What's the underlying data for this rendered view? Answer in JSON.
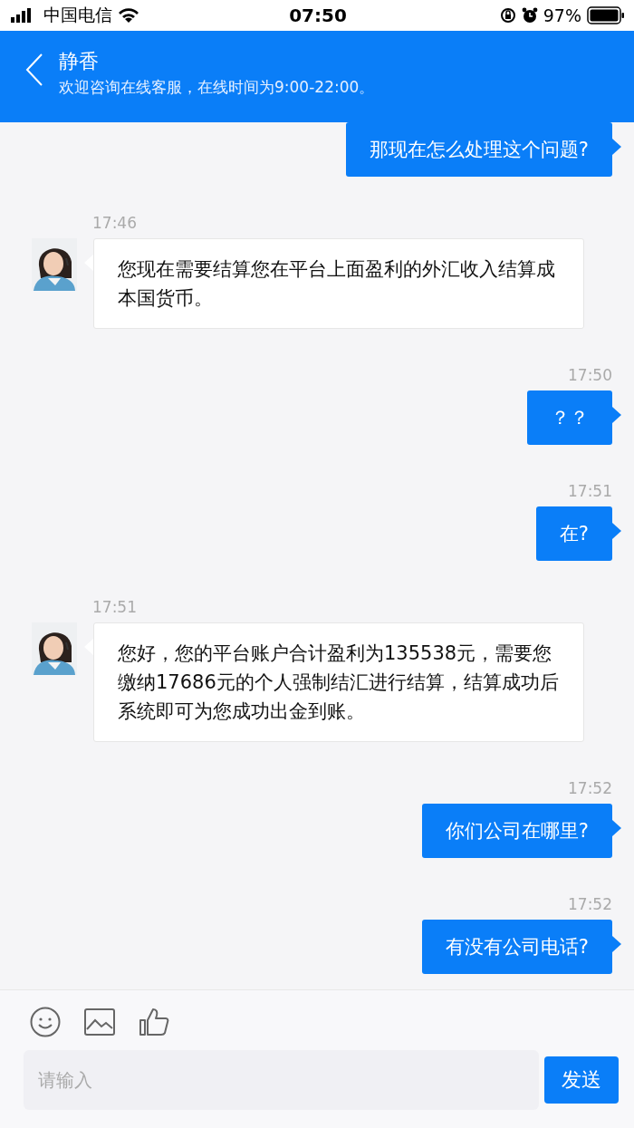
{
  "status_bar": {
    "carrier": "中国电信",
    "time": "07:50",
    "battery": "97%"
  },
  "header": {
    "title": "静香",
    "subtitle": "欢迎咨询在线客服，在线时间为9:00-22:00。"
  },
  "messages": [
    {
      "kind": "sent",
      "text": "那现在怎么处理这个问题?"
    },
    {
      "kind": "received",
      "time": "17:46",
      "text": "您现在需要结算您在平台上面盈利的外汇收入结算成本国货币。"
    },
    {
      "kind": "sent",
      "time": "17:50",
      "text": "？？"
    },
    {
      "kind": "sent",
      "time": "17:51",
      "text": "在?"
    },
    {
      "kind": "received",
      "time": "17:51",
      "text": "您好，您的平台账户合计盈利为135538元，需要您缴纳17686元的个人强制结汇进行结算，结算成功后系统即可为您成功出金到账。"
    },
    {
      "kind": "sent",
      "time": "17:52",
      "text": "你们公司在哪里?"
    },
    {
      "kind": "sent",
      "time": "17:52",
      "text": "有没有公司电话?"
    }
  ],
  "composer": {
    "placeholder": "请输入",
    "send": "发送"
  }
}
